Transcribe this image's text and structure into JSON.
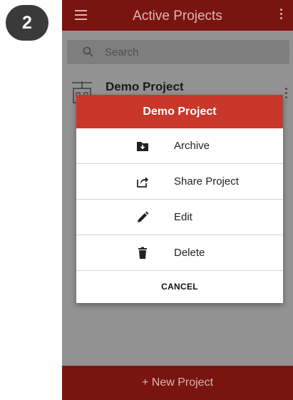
{
  "step_badge": "2",
  "appbar": {
    "title": "Active Projects",
    "menu_icon": "hamburger-icon",
    "more_icon": "more-vertical-icon"
  },
  "search": {
    "placeholder": "Search",
    "icon": "search-icon"
  },
  "project": {
    "name": "Demo Project",
    "icon": "project-crane-icon"
  },
  "dialog": {
    "title": "Demo Project",
    "options": [
      {
        "label": "Archive",
        "icon": "archive-icon"
      },
      {
        "label": "Share Project",
        "icon": "share-icon"
      },
      {
        "label": "Edit",
        "icon": "edit-pencil-icon"
      },
      {
        "label": "Delete",
        "icon": "delete-trash-icon"
      }
    ],
    "cancel": "CANCEL"
  },
  "bottom_bar": {
    "label": "+ New Project"
  },
  "colors": {
    "appbar": "#7a140f",
    "dialog_header": "#c8372a",
    "overlay": "#929292"
  }
}
